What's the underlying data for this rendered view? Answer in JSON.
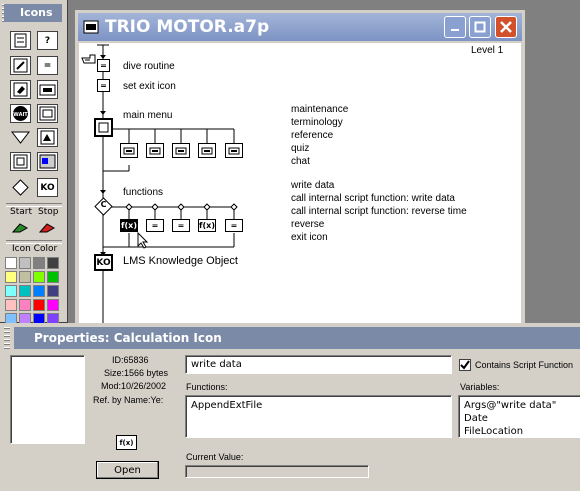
{
  "palette": {
    "title": "Icons",
    "start_label": "Start",
    "stop_label": "Stop",
    "icon_color_label": "Icon Color",
    "tools": [
      "calculation",
      "decision",
      "interaction",
      "display",
      "wait",
      "motion",
      "erase",
      "navigate",
      "framework",
      "map",
      "sound",
      "movie",
      "digital-movie",
      "knowledge-object"
    ],
    "colors": [
      "#ffffff",
      "#c0c0c0",
      "#808080",
      "#404040",
      "#ffff80",
      "#c0c0a0",
      "#80ff00",
      "#00c000",
      "#80ffff",
      "#00c0c0",
      "#0080ff",
      "#404080",
      "#ffc0c0",
      "#ff80c0",
      "#ff0000",
      "#ff00ff",
      "#80c0ff",
      "#c080ff",
      "#0000ff",
      "#8040ff"
    ]
  },
  "window": {
    "title": "TRIO MOTOR.a7p",
    "level": "Level 1",
    "flow": {
      "dive": "dive routine",
      "exit": "set exit icon",
      "main_menu": "main menu",
      "functions": "functions",
      "lms": "LMS Knowledge Object",
      "decision_letter": "C",
      "calc_symbol": "=",
      "func_symbol": "f(x)",
      "ko_symbol": "KO"
    },
    "menu_items": [
      "maintenance",
      "terminology",
      "reference",
      "quiz",
      "chat"
    ],
    "function_items": [
      "write data",
      "call internal script function: write data",
      "call internal script function: reverse time",
      "reverse",
      "exit icon"
    ]
  },
  "properties": {
    "title": "Properties: Calculation Icon",
    "id": "ID:65836",
    "size": "Size:1566 bytes",
    "mod": "Mod:10/26/2002",
    "ref": "Ref. by Name:Ye:",
    "icon_symbol": "f(x)",
    "open_label": "Open",
    "name_value": "write data",
    "contains_script_label": "Contains Script Function",
    "contains_script_checked": true,
    "functions_label": "Functions:",
    "functions": [
      "AppendExtFile"
    ],
    "variables_label": "Variables:",
    "variables": [
      "Args@\"write data\"",
      "Date",
      "FileLocation"
    ],
    "current_value_label": "Current Value:"
  }
}
